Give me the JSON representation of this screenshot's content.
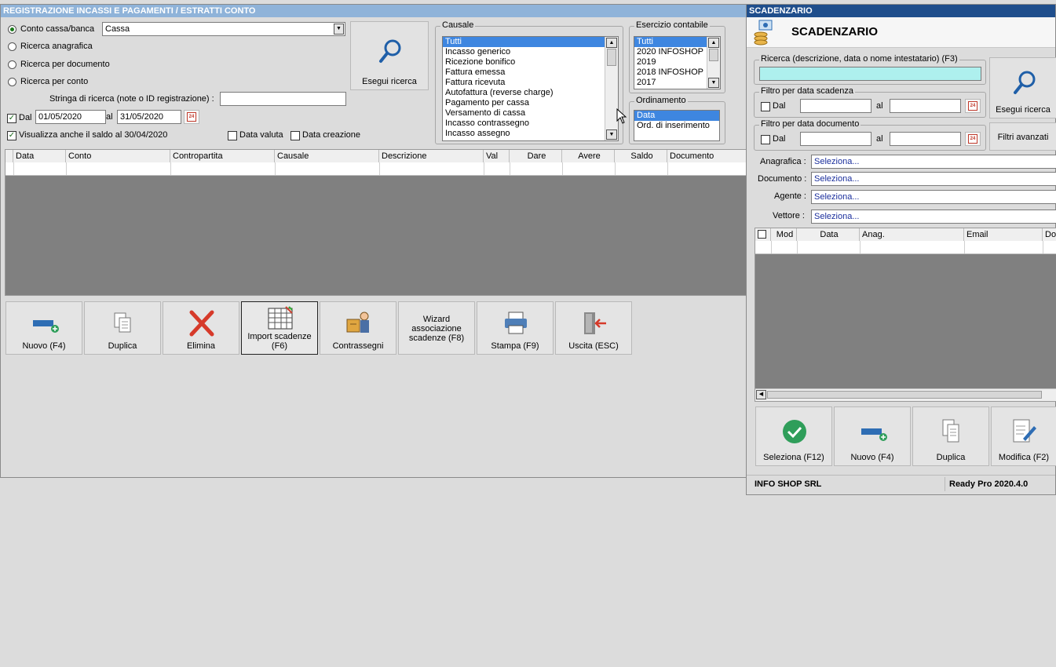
{
  "left_window": {
    "title": "REGISTRAZIONE INCASSI E PAGAMENTI / ESTRATTI CONTO",
    "search_modes": [
      "Conto cassa/banca",
      "Ricerca anagrafica",
      "Ricerca per documento",
      "Ricerca per conto"
    ],
    "selected_search_mode": "Conto cassa/banca",
    "conto_value": "Cassa",
    "search_string_label": "Stringa di ricerca (note o ID registrazione) :",
    "search_string_value": "",
    "dal_label": "Dal",
    "dal_checked": true,
    "date_from": "01/05/2020",
    "al_label": "al",
    "date_to": "31/05/2020",
    "calendar_day": "24",
    "saldo_label": "Visualizza anche il saldo al 30/04/2020",
    "saldo_checked": true,
    "data_valuta_label": "Data valuta",
    "data_creazione_label": "Data creazione",
    "search_button": "Esegui ricerca",
    "causale": {
      "legend": "Causale",
      "items": [
        "Tutti",
        "Incasso generico",
        "Ricezione bonifico",
        "Fattura emessa",
        "Fattura ricevuta",
        "Autofattura (reverse charge)",
        "Pagamento per cassa",
        "Versamento di cassa",
        "Incasso contrassegno",
        "Incasso assegno"
      ],
      "selected": "Tutti"
    },
    "esercizio": {
      "legend": "Esercizio contabile",
      "items": [
        "Tutti",
        "2020 INFOSHOP",
        "2019",
        "2018 INFOSHOP",
        "2017"
      ],
      "selected": "Tutti"
    },
    "ordinamento": {
      "legend": "Ordinamento",
      "items": [
        "Data",
        "Ord. di inserimento"
      ],
      "selected": "Data"
    },
    "table_columns": [
      "Data",
      "Conto",
      "Contropartita",
      "Causale",
      "Descrizione",
      "Val",
      "Dare",
      "Avere",
      "Saldo",
      "Documento"
    ],
    "toolbar": {
      "nuovo": "Nuovo (F4)",
      "duplica": "Duplica",
      "elimina": "Elimina",
      "import_1": "Import scadenze",
      "import_2": "(F6)",
      "contrassegni": "Contrassegni",
      "wizard_1": "Wizard",
      "wizard_2": "associazione",
      "wizard_3": "scadenze (F8)",
      "stampa": "Stampa (F9)",
      "uscita": "Uscita (ESC)"
    }
  },
  "right_window": {
    "title": "SCADENZARIO",
    "header": "SCADENZARIO",
    "ricerca_legend": "Ricerca (descrizione, data o nome intestatario) (F3)",
    "ricerca_value": "",
    "search_button": "Esegui ricerca",
    "scadenza_legend": "Filtro per data scadenza",
    "documento_legend": "Filtro per data documento",
    "dal_label": "Dal",
    "al_label": "al",
    "calendar_day": "24",
    "filtri_avanzati": "Filtri avanzati",
    "fields": {
      "anagrafica_label": "Anagrafica :",
      "documento_label": "Documento :",
      "agente_label": "Agente :",
      "vettore_label": "Vettore :",
      "placeholder": "Seleziona..."
    },
    "table_columns": [
      "Mod",
      "Data",
      "Anag.",
      "Email",
      "Doc"
    ],
    "toolbar": {
      "seleziona": "Seleziona (F12)",
      "nuovo": "Nuovo (F4)",
      "duplica": "Duplica",
      "modifica": "Modifica (F2)"
    },
    "status_company": "INFO SHOP SRL",
    "status_version": "Ready Pro 2020.4.0"
  },
  "colors": {
    "title_light": "#8fb3d9",
    "title_dark": "#1f4e8c",
    "selection": "#3e86e0",
    "grid_empty": "#808080",
    "search_field": "#aef0ee"
  }
}
